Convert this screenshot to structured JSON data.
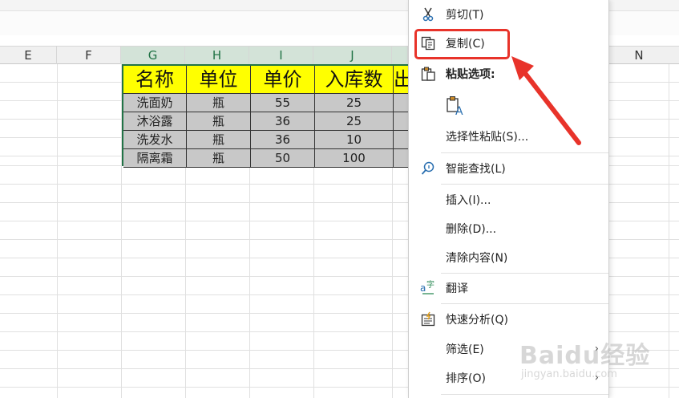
{
  "columns": {
    "E": "E",
    "F": "F",
    "G": "G",
    "H": "H",
    "I": "I",
    "J": "J",
    "N": "N"
  },
  "table": {
    "headers": [
      "名称",
      "单位",
      "单价",
      "入库数",
      "出"
    ],
    "rows": [
      [
        "洗面奶",
        "瓶",
        "55",
        "25"
      ],
      [
        "沐浴露",
        "瓶",
        "36",
        "25"
      ],
      [
        "洗发水",
        "瓶",
        "36",
        "10"
      ],
      [
        "隔离霜",
        "瓶",
        "50",
        "100"
      ]
    ]
  },
  "context_menu": {
    "cut": "剪切(T)",
    "copy": "复制(C)",
    "paste_options": "粘贴选项:",
    "paste_special": "选择性粘贴(S)...",
    "smart_lookup": "智能查找(L)",
    "insert": "插入(I)...",
    "delete": "删除(D)...",
    "clear_contents": "清除内容(N)",
    "translate": "翻译",
    "quick_analysis": "快速分析(Q)",
    "filter": "筛选(E)",
    "sort": "排序(O)"
  },
  "watermark": {
    "brand": "Baidu经验",
    "url": "jingyan.baidu.com"
  },
  "colors": {
    "header_fill": "#ffff00",
    "row_fill": "#c8c8c8",
    "selection_green": "#217346",
    "annotation_red": "#e8332a"
  }
}
